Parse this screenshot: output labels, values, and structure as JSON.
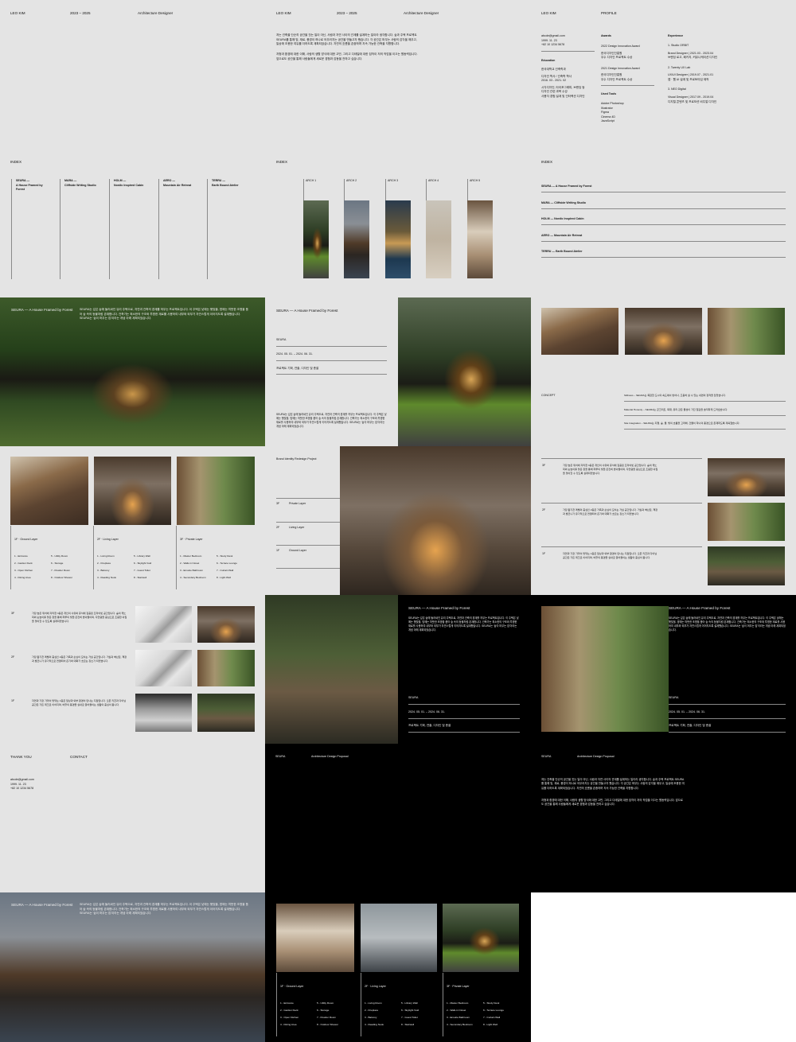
{
  "header": {
    "name": "LEO KIM",
    "years": "2023 – 2025",
    "role": "Architecture Designer"
  },
  "intro": {
    "paragraph1": "저는 건축을 단순히 공간을 짓는 일이 아닌, 사람과 자연 사이의 관계를 설계하는 일이라 생각합니다. 숲과 주택 프로젝트 SEURA를 통해 빛, 재료, 풍경이 하나로 어우러지는 공간을 만들고자 했습니다. 각 공간은 머무는 사람의 감각을 깨우고, 일상에 조용한 여유를 더하도록 계획되었습니다. 자연의 흐름을 존중하며 지속 가능한 건축을 지향합니다.",
    "paragraph2": "지형과 환경에 대한 이해, 사람의 생활 방식에 대한 고민, 그리고 디테일에 대한 집착이 저의 작업을 이끄는 원동력입니다. 앞으로도 공간을 통해 사람들에게 새로운 경험과 감동을 전하고 싶습니다."
  },
  "profile": {
    "name": "LEO KIM",
    "title": "PROFILE",
    "contact": [
      "abcde@gmail.com",
      "1999. 11. 23",
      "+82 10 1234 5678"
    ],
    "education_label": "Education",
    "education": [
      "한국대학교 건축학과",
      "디자인 학사 / 건축학 학사",
      "2016. 03 - 2021. 02",
      "시각디자인, 타이포그래피, 브랜딩 등",
      "디자인 관련 과목 수강",
      "사용자 경험 설계 및 인터랙션 디자인"
    ],
    "awards_label": "Awards",
    "awards": [
      {
        "name": "2022 Design Innovation Award",
        "desc": [
          "한국디자인진흥원",
          "우수 디자인 프로젝트 수상"
        ]
      },
      {
        "name": "2021 Design Innovation Award",
        "desc": [
          "한국디자인진흥원",
          "우수 디자인 프로젝트 수상"
        ]
      }
    ],
    "tools_label": "Used Tools",
    "tools": [
      "Adobe Photoshop",
      "Illustrator",
      "Figma",
      "Cinema 4D",
      "JavaScript"
    ],
    "experience_label": "Experience",
    "experience": [
      {
        "company": "1. Studio ORBIT",
        "role": "Brand Designer | 2021.03 - 2023.04",
        "desc": "브랜딩 로고, 패키지, 커뮤니케이션 디자인"
      },
      {
        "company": "2. Twenty UX Lab",
        "role": "UX/UI Designer | 2019.07 - 2021.01",
        "desc": "앱 · 웹 UI 설계 및 프로토타입 제작"
      },
      {
        "company": "3. NEO Digital",
        "role": "Visual Designer | 2017.09 - 2019.04",
        "desc": "디지털 콘텐츠 및 프로모션 비주얼 디자인"
      }
    ]
  },
  "index_label": "INDEX",
  "projects": [
    {
      "code": "SEURA —",
      "title": "A House Framed by Forest",
      "full": "SEURA — A House Framed by Forest"
    },
    {
      "code": "MARA —",
      "title": "Cliffside Writing Studio",
      "full": "MARA — Cliffside Writing Studio"
    },
    {
      "code": "HOLM —",
      "title": "Nordic Inspired Cabin",
      "full": "HOLM — Nordic Inspired Cabin"
    },
    {
      "code": "AERO —",
      "title": "Mountain Air Retreat",
      "full": "AERO — Mountain Air Retreat"
    },
    {
      "code": "TERRU —",
      "title": "Earth Bound Atelier",
      "full": "TERRU — Earth Bound Atelier"
    }
  ],
  "arch_labels": [
    "ARCH 1",
    "ARCH 2",
    "ARCH 3",
    "ARCH 4",
    "ARCH 5"
  ],
  "seura": {
    "title": "SEURA — A House Framed by Forest",
    "name": "SEURA",
    "period": "2024. 05. 01. – 2024. 06. 31.",
    "scope": "프로젝트 기획, 연출, 디자인 및 총괄",
    "description": "SEURA는 깊은 숲에 둘러싸인 유리 주택으로, 자연과 건축의 경계를 허무는 프로젝트입니다. 이 주택은 낮에는 햇빛을, 밤에는 따뜻한 조명을 품어 숲 속의 등불처럼 존재합니다. 건축가는 최소한의 구조와 투명한 재료를 사용하여 내부와 외부가 자연스럽게 이어지도록 설계했습니다. SEURA는 '숲이 머무는 집'이라는 개념 아래 계획되었습니다."
  },
  "concept": {
    "label": "CONCEPT",
    "items": [
      "Stillness – SEURA는 복잡한 도시의 속도에서 벗어나, 조용히 쉴 수 있는 내면의 정적을 담았습니다.",
      "Material Honesty – SEURA는 콘크리트, 목재, 유리 같은 물성이 가진 질감을 솔직하게 드러냈습니다.",
      "Site Integration – SEURA는 지형, 숲, 물, 빛의 흐름을 고려해, 건물이 하나의 풍경으로 존재하도록 계획했습니다."
    ]
  },
  "floors": [
    {
      "label": "1F  ·  Ground Layer",
      "rooms": [
        "1 - Entrance",
        "2 - Garden Deck",
        "3 - Open Kitchen",
        "4 - Dining Area",
        "5 - Utility Room",
        "6 - Storage",
        "7 - Powder Room",
        "8 - Outdoor Shower"
      ]
    },
    {
      "label": "2F  ·  Living Layer",
      "rooms": [
        "1 - Living Room",
        "2 - Fireplace",
        "3 - Balcony",
        "4 - Reading Nook",
        "5 - Library Wall",
        "6 - Skylight Void",
        "7 - Guest Toilet",
        "8 - Stairwell"
      ]
    },
    {
      "label": "3F  ·  Private Layer",
      "rooms": [
        "1 - Master Bedroom",
        "2 - Walk-in Closet",
        "3 - Ensuite Bathroom",
        "4 - Secondary Bedroom",
        "5 - Study Desk",
        "6 - Terrace Lounge",
        "7 - Curtain Wall",
        "8 - Light Well"
      ]
    }
  ],
  "layers_panel": {
    "title": "Brand Identity Redesign Project",
    "rows": [
      {
        "floor": "3F",
        "name": "Private Layer"
      },
      {
        "floor": "2F",
        "name": "Living Layer"
      },
      {
        "floor": "1F",
        "name": "Ground Layer"
      }
    ]
  },
  "floor_details": [
    {
      "floor": "3F",
      "text": "가장 높은 위치에 자리한 3층은 개인의 사유와 휴식에 집중된 프라이빗 공간입니다. 숲의 캐노피와 눈높이를 맞춘 창을 통해 하루의 빛을 온전히 받아들이며, 자연광을 중심으로 조용한 아침을 맞이할 수 있도록 설계되었습니다."
    },
    {
      "floor": "2F",
      "text": "가장 활기찬 레벨의 중심인 2층은 가족과 손님이 모이는 거실 공간입니다. 거실과 벽난로, 책장과 발코니가 유기적으로 연결되어 온기와 대화가 흐르는 장소가 되었습니다."
    },
    {
      "floor": "1F",
      "text": "자연과 가장 가까이 맞닿는 1층은 일상과 외부 환경이 만나는 지점입니다. 오픈 키친과 다이닝 공간은 가든 데크로 이어지며, 바깥의 풍경을 실내로 끌어들이는 생활의 중심이 됩니다."
    }
  ],
  "closing": {
    "thanks": "THANK YOU",
    "contact_label": "CONTACT",
    "contact": [
      "abcde@gmail.com",
      "1999. 11. 23",
      "+82 10 1234 5678"
    ]
  },
  "proposal": {
    "code": "SEURA",
    "title": "Architecture Design Proposal"
  }
}
